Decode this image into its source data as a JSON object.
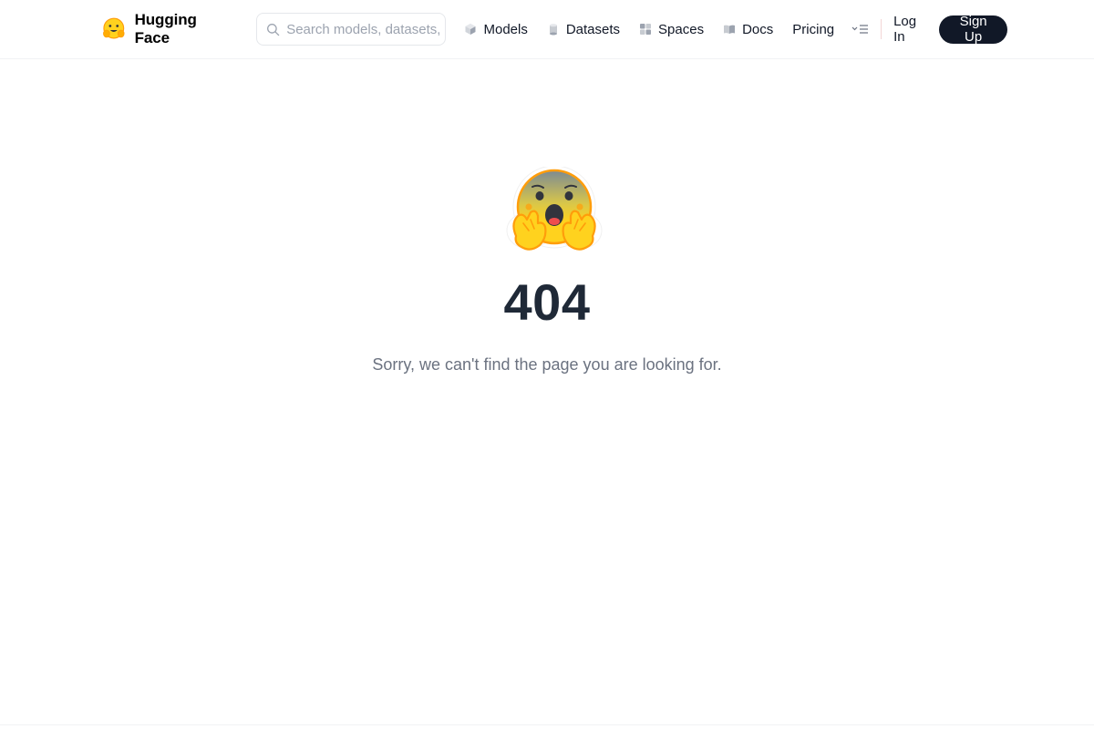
{
  "header": {
    "brand_name": "Hugging Face",
    "search": {
      "placeholder": "Search models, datasets, users..."
    },
    "nav": [
      {
        "label": "Models",
        "icon": "cube-icon"
      },
      {
        "label": "Datasets",
        "icon": "database-icon"
      },
      {
        "label": "Spaces",
        "icon": "grid-icon"
      },
      {
        "label": "Docs",
        "icon": "book-icon"
      },
      {
        "label": "Pricing",
        "icon": ""
      }
    ],
    "more_icon": "menu-more-icon",
    "login_label": "Log In",
    "signup_label": "Sign Up"
  },
  "error": {
    "code": "404",
    "message": "Sorry, we can't find the page you are looking for.",
    "emoji": "scared-hugging-face-emoji"
  },
  "colors": {
    "signup_bg": "#111827",
    "code_text": "#1f2937",
    "message_text": "#6b7280"
  }
}
